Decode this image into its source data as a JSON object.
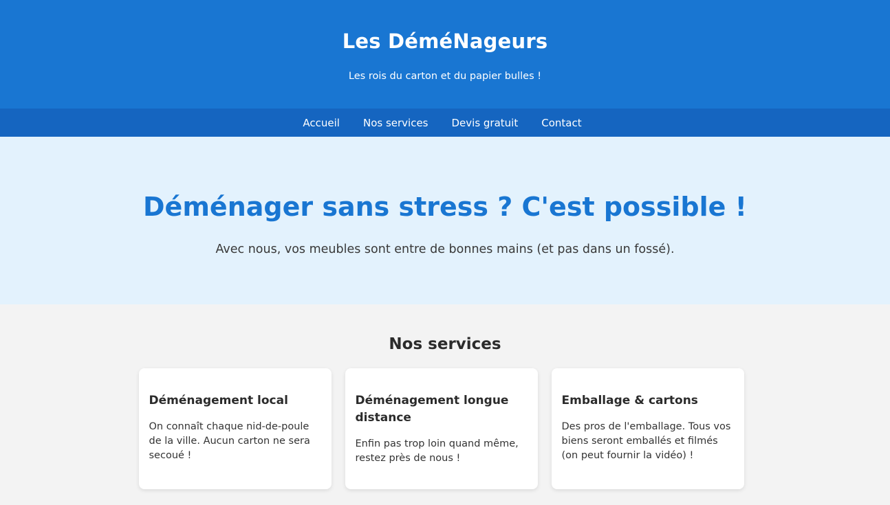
{
  "header": {
    "title": "Les DéméNageurs",
    "tagline": "Les rois du carton et du papier bulles !"
  },
  "nav": {
    "items": [
      {
        "label": "Accueil"
      },
      {
        "label": "Nos services"
      },
      {
        "label": "Devis gratuit"
      },
      {
        "label": "Contact"
      }
    ]
  },
  "hero": {
    "title": "Déménager sans stress ? C'est possible !",
    "text": "Avec nous, vos meubles sont entre de bonnes mains (et pas dans un fossé)."
  },
  "services": {
    "title": "Nos services",
    "cards": [
      {
        "title": "Déménagement local",
        "text": "On connaît chaque nid-de-poule de la ville. Aucun carton ne sera secoué !"
      },
      {
        "title": "Déménagement longue distance",
        "text": "Enfin pas trop loin quand même, restez près de nous !"
      },
      {
        "title": "Emballage & cartons",
        "text": "Des pros de l'emballage. Tous vos biens seront emballés et filmés (on peut fournir la vidéo) !"
      }
    ]
  },
  "colors": {
    "header_bg": "#1976d2",
    "nav_bg": "#1565c0",
    "hero_bg": "#e3f2fd",
    "accent": "#1976d2",
    "page_bg": "#f3f3f3",
    "card_bg": "#ffffff"
  }
}
